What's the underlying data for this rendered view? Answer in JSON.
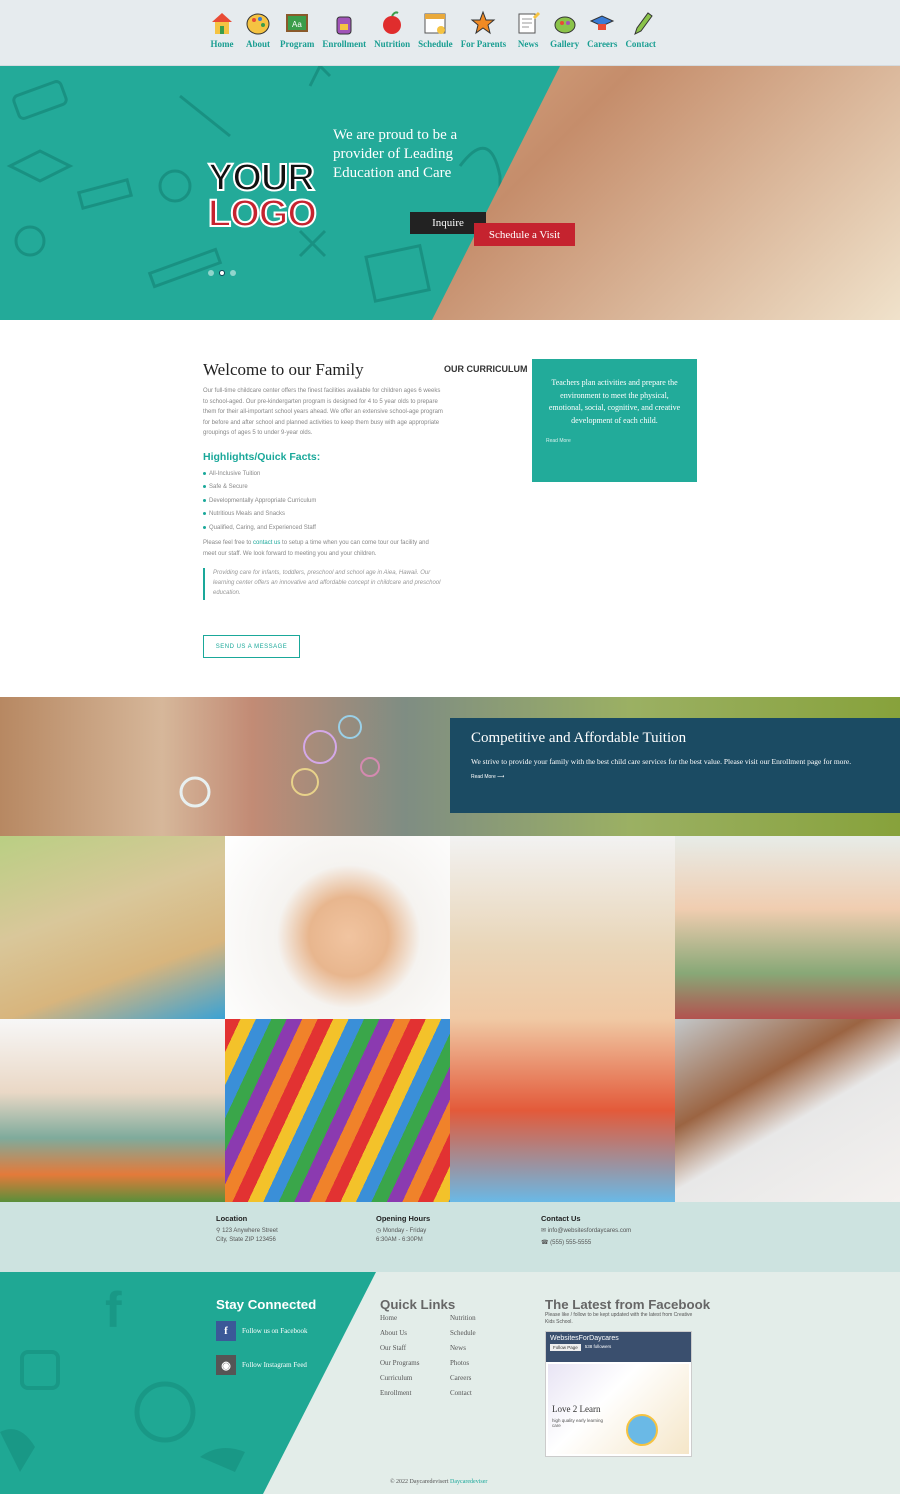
{
  "nav": {
    "items": [
      {
        "label": "Home",
        "icon": "house-icon"
      },
      {
        "label": "About",
        "icon": "palette-icon"
      },
      {
        "label": "Program",
        "icon": "chalkboard-icon"
      },
      {
        "label": "Enrollment",
        "icon": "backpack-icon"
      },
      {
        "label": "Nutrition",
        "icon": "apple-icon"
      },
      {
        "label": "Schedule",
        "icon": "calendar-icon"
      },
      {
        "label": "For Parents",
        "icon": "star-icon"
      },
      {
        "label": "News",
        "icon": "notepad-icon"
      },
      {
        "label": "Gallery",
        "icon": "paint-icon"
      },
      {
        "label": "Careers",
        "icon": "graduation-cap-icon"
      },
      {
        "label": "Contact",
        "icon": "pencil-icon"
      }
    ]
  },
  "hero": {
    "logo_line1": "YOUR",
    "logo_line2": "LOGO",
    "tagline": "We are proud to be a provider of Leading Education and Care",
    "inquire_label": "Inquire",
    "visit_label": "Schedule a Visit"
  },
  "welcome": {
    "title": "Welcome to our Family",
    "intro": "Our full-time childcare center offers the finest facilities available for children ages 6 weeks to school-aged. Our pre-kindergarten program is designed for 4 to 5 year olds to prepare them for their all-important school years ahead. We offer an extensive school-age program for before and after school and planned activities to keep them busy with age appropriate groupings of ages 5 to under 9-year olds.",
    "facts_title": "Highlights/Quick Facts:",
    "facts": [
      "All-Inclusive Tuition",
      "Safe & Secure",
      "Developmentally Appropriate Curriculum",
      "Nutritious Meals and Snacks",
      "Qualified, Caring, and Experienced Staff"
    ],
    "contact_pre": "Please feel free to ",
    "contact_link": "contact us",
    "contact_post": " to setup a time when you can come tour our facility and meet our staff. We look forward to meeting you and your children.",
    "quote": "Providing care for infants, toddlers, preschool and school age in Aiea, Hawaii. Our learning center offers an innovative and affordable concept in childcare and preschool education.",
    "message_button": "SEND US A MESSAGE"
  },
  "curriculum": {
    "title": "OUR CURRICULUM",
    "text": "Teachers plan activities and prepare the environment to meet the physical, emotional, social, cognitive, and creative development of each child.",
    "more": "Read More"
  },
  "tuition": {
    "title": "Competitive and Affordable Tuition",
    "text": "We strive to provide your family with the best child care services for the best value. Please visit our Enrollment page for more.",
    "more": "Read More ⟶"
  },
  "info": {
    "location_title": "Location",
    "address1": "123 Anywhere Street",
    "address2": "City, State ZIP 123456",
    "hours_title": "Opening Hours",
    "days": "Monday - Friday",
    "hours": "6:30AM - 6:30PM",
    "contact_title": "Contact Us",
    "email": "info@websitesfordaycares.com",
    "phone": "(555) 555-5555"
  },
  "footer": {
    "stay_title": "Stay Connected",
    "facebook_label": "Follow us on Facebook",
    "instagram_label": "Follow Instagram Feed",
    "links_title": "Quick Links",
    "links_col1": [
      "Home",
      "About Us",
      "Our Staff",
      "Our Programs",
      "Curriculum",
      "Enrollment"
    ],
    "links_col2": [
      "Nutrition",
      "Schedule",
      "News",
      "Photos",
      "Careers",
      "Contact"
    ],
    "fb_title": "The Latest from Facebook",
    "fb_text": "Please like / follow to be kept updated with the latest from Creative Kids School.",
    "fb_page_name": "WebsitesForDaycares",
    "fb_follow": "Follow Page",
    "fb_followers": "538 followers",
    "fb_post_title": "Love 2 Learn",
    "fb_post_sub": "high quality early learning care",
    "copyright_pre": "© 2022 Daycaredevisert",
    "copyright_brand": "Daycaredeviser"
  },
  "colors": {
    "teal": "#22ab9a",
    "navy": "#1b4b63",
    "red": "#c5232f"
  }
}
